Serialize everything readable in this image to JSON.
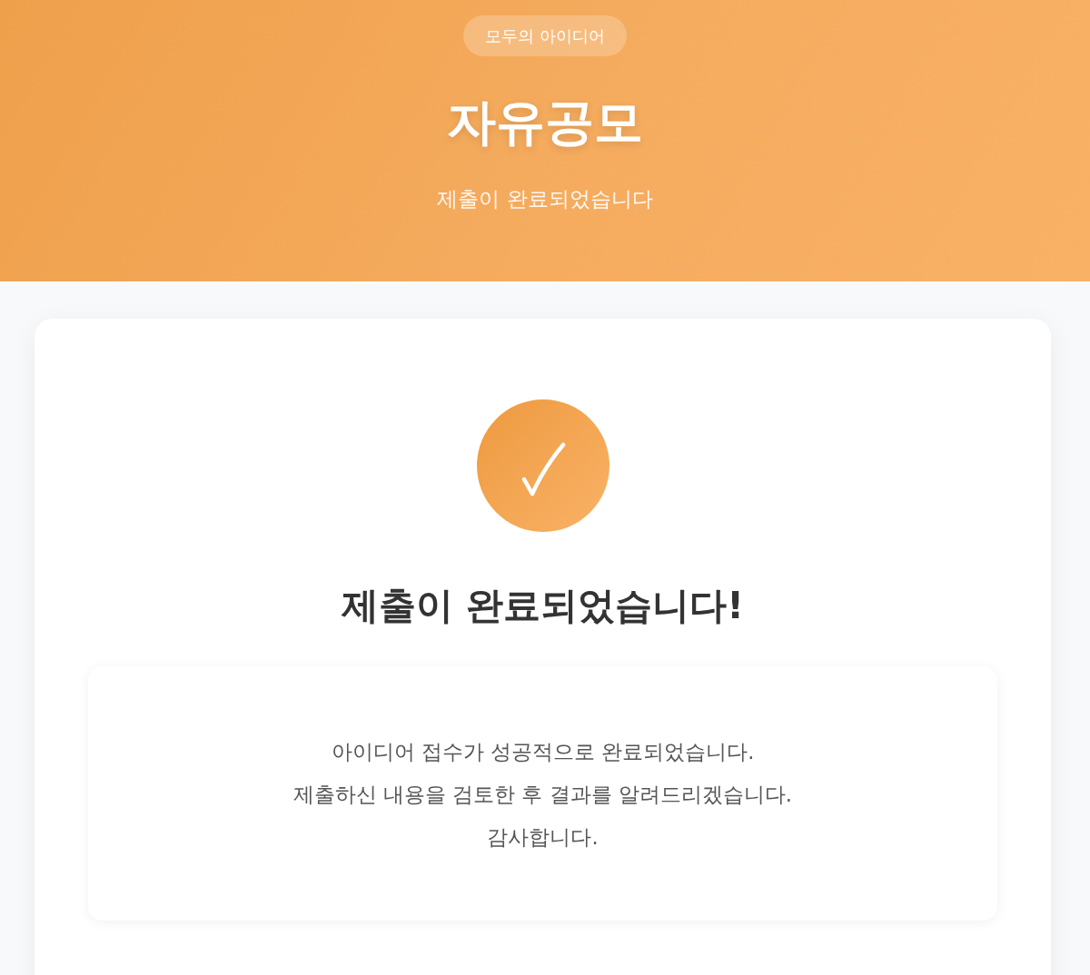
{
  "header": {
    "badge": "모두의 아이디어",
    "title": "자유공모",
    "subtitle": "제출이 완료되었습니다"
  },
  "result": {
    "heading": "제출이 완료되었습니다!",
    "message_lines": [
      "아이디어 접수가 성공적으로 완료되었습니다.",
      "제출하신 내용을 검토한 후 결과를 알려드리겠습니다.",
      "감사합니다."
    ]
  }
}
